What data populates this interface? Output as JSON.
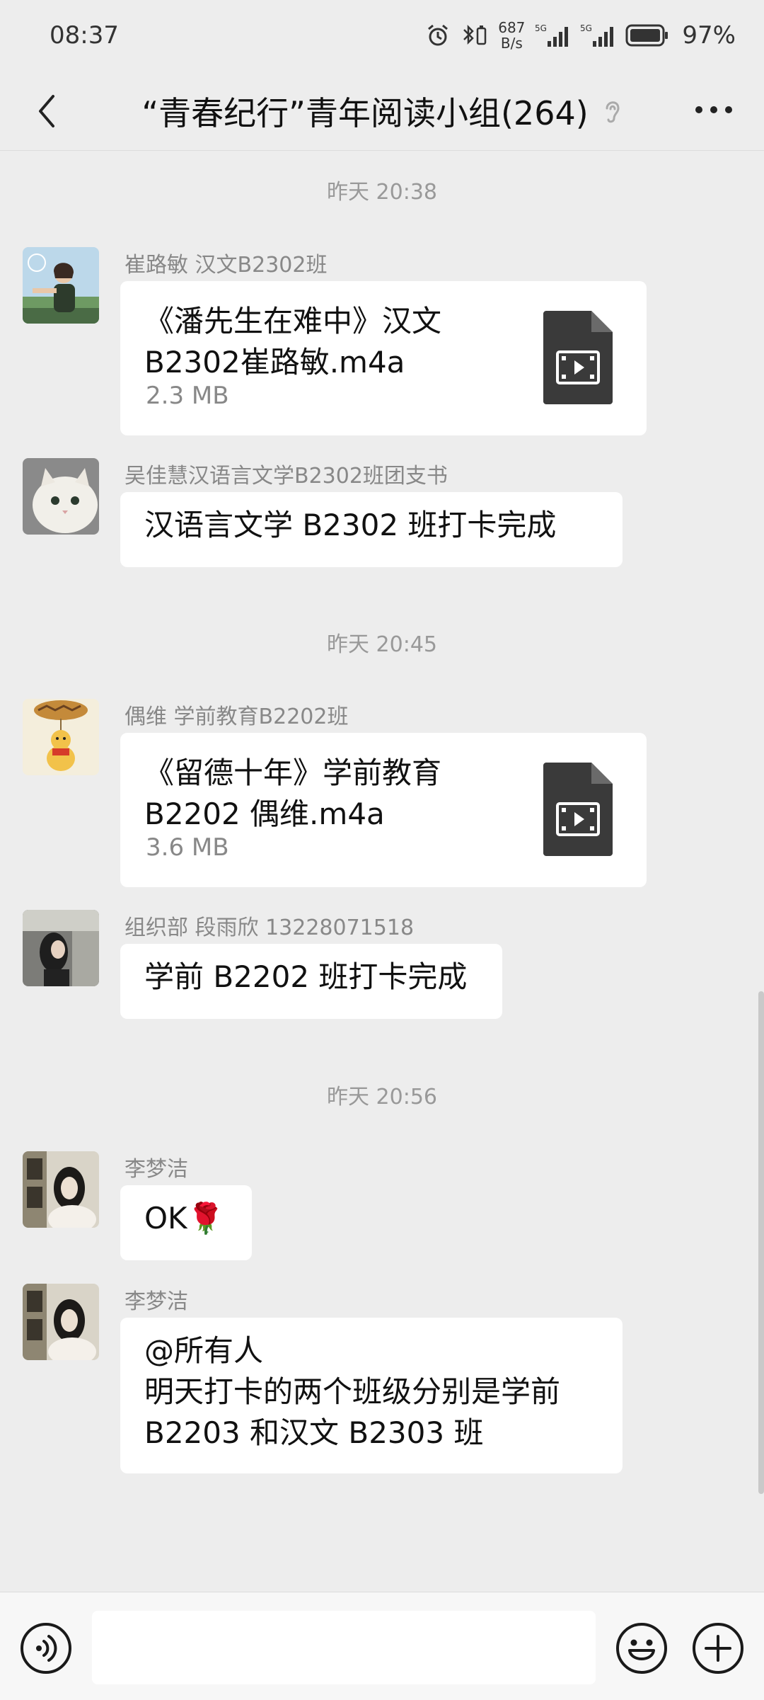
{
  "status_bar": {
    "time": "08:37",
    "net_speed_value": "687",
    "net_speed_unit": "B/s",
    "signal_label_1": "5G",
    "signal_label_2": "5G",
    "battery": "97%"
  },
  "header": {
    "title": "“青春纪行”青年阅读小组(264)",
    "back_icon": "chevron-left-icon",
    "ear_icon": "ear-icon",
    "more_icon": "more-dots-icon"
  },
  "messages": [
    {
      "type": "timestamp",
      "text": "昨天 20:38"
    },
    {
      "type": "file",
      "sender": "崔路敏 汉文B2302班",
      "file_name": "《潘先生在难中》汉文B2302崔路敏.m4a",
      "file_size": "2.3 MB",
      "icon": "video-file-icon"
    },
    {
      "type": "text",
      "sender": "吴佳慧汉语言文学B2302班团支书",
      "text": "汉语言文学 B2302 班打卡完成"
    },
    {
      "type": "timestamp",
      "text": "昨天 20:45"
    },
    {
      "type": "file",
      "sender": "偶维 学前教育B2202班",
      "file_name": "《留德十年》学前教育B2202 偶维.m4a",
      "file_size": "3.6 MB",
      "icon": "video-file-icon"
    },
    {
      "type": "text",
      "sender": "组织部 段雨欣 13228071518",
      "text": "学前 B2202 班打卡完成"
    },
    {
      "type": "timestamp",
      "text": "昨天 20:56"
    },
    {
      "type": "text",
      "sender": "李梦洁",
      "text": "OK🌹"
    },
    {
      "type": "text",
      "sender": "李梦洁",
      "text_lines": [
        "@所有人",
        "明天打卡的两个班级分别是学前",
        "B2203 和汉文 B2303 班"
      ]
    }
  ],
  "input_bar": {
    "voice_icon": "voice-icon",
    "placeholder": "",
    "emoji_icon": "emoji-icon",
    "plus_icon": "plus-icon"
  }
}
